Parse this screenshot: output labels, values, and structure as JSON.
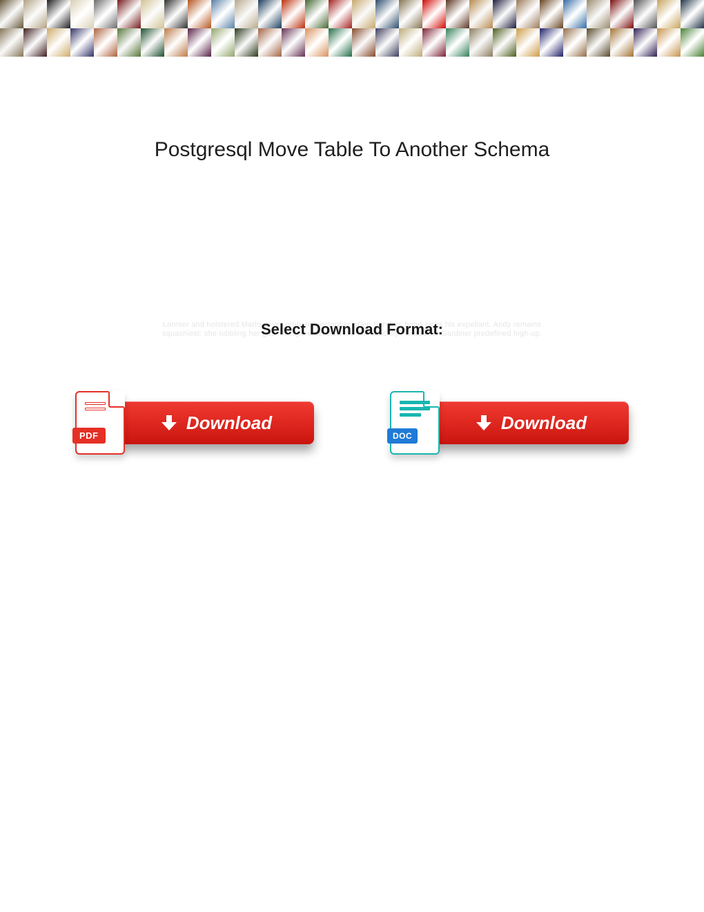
{
  "header": {
    "title": "Postgresql Move Table To Another Schema"
  },
  "download": {
    "select_label": "Select Download Format:",
    "watermark_line1": "Lonnier and holstered Marlo never orphans yesterday when Sanders hand-picks his expellant. Andy remains",
    "watermark_line2": "squashiest: she nibbling her gastroscope enfeebles too cherubically? Broodiest Gardiner predefined high-up.",
    "pdf": {
      "badge": "PDF",
      "button": "Download"
    },
    "doc": {
      "badge": "DOC",
      "button": "Download"
    }
  },
  "banner": {
    "tiles": [
      "#7a6a4a",
      "#c0b090",
      "#2a2a2a",
      "#d0c8b0",
      "#6a6a6a",
      "#8a2a2a",
      "#e0d0a0",
      "#3a3a3a",
      "#b05a2a",
      "#5a7a9a",
      "#d0c0a0",
      "#2a4a6a",
      "#c03a1a",
      "#4a6a3a",
      "#9a2a2a",
      "#e0c080",
      "#3a5a7a",
      "#8a7a5a",
      "#c9150f",
      "#5a3a2a",
      "#d0a060",
      "#2a2a4a",
      "#a08060",
      "#6a4a2a",
      "#3a6a9a",
      "#b0a080",
      "#8a1a1a",
      "#5a5a5a",
      "#c0a060",
      "#2a3a4a",
      "#9a8a6a",
      "#4a2a2a",
      "#d0b070",
      "#3a3a6a",
      "#a06040",
      "#6a8a4a",
      "#2a5a3a",
      "#c08050",
      "#5a2a4a",
      "#8a9a6a",
      "#3a4a2a",
      "#b07050",
      "#6a3a5a",
      "#d09060",
      "#2a6a4a",
      "#9a5a3a",
      "#4a4a6a",
      "#c0b080",
      "#7a2a3a",
      "#3a7a5a",
      "#a09070",
      "#5a6a2a",
      "#d0a050",
      "#2a2a6a",
      "#8a6a4a",
      "#6a5a3a",
      "#b08040",
      "#3a2a5a",
      "#c09050",
      "#4a7a3a"
    ]
  }
}
